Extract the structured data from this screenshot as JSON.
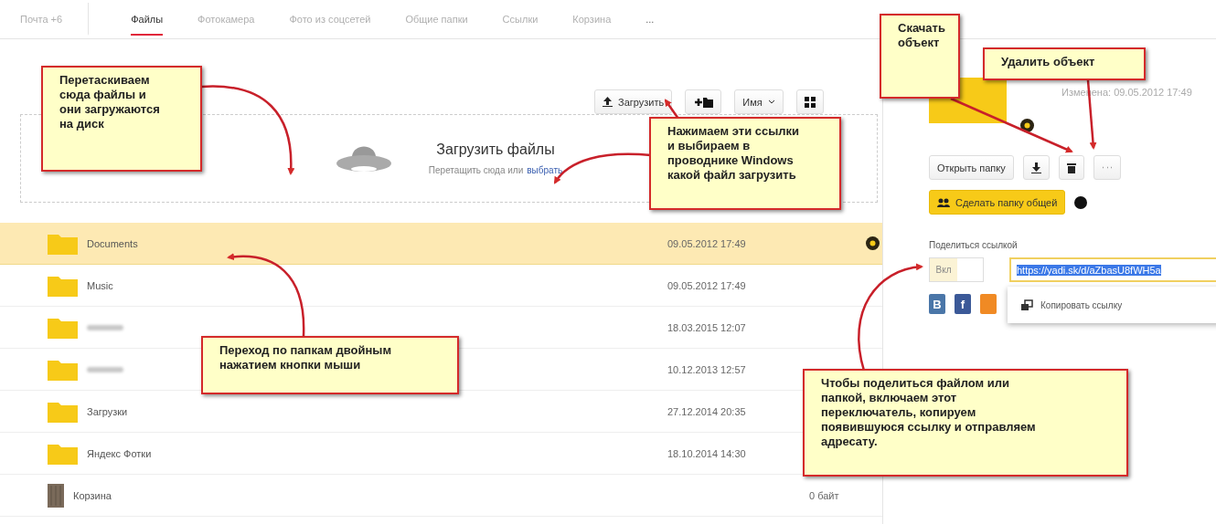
{
  "tabs": [
    {
      "label": "Почта +6",
      "selected": false
    },
    {
      "label": "Файлы",
      "selected": true
    },
    {
      "label": "Фотокамера",
      "selected": false
    },
    {
      "label": "Фото из соцсетей",
      "selected": false
    },
    {
      "label": "Общие папки",
      "selected": false
    },
    {
      "label": "Ссылки",
      "selected": false
    },
    {
      "label": "Корзина",
      "selected": false
    }
  ],
  "more_tabs": "...",
  "toolbar": {
    "upload_button": "Загрузить",
    "sort_button": "Имя"
  },
  "upload_zone": {
    "title": "Загрузить файлы",
    "hint": "Перетащить сюда или",
    "link": "выбрать"
  },
  "files": [
    {
      "kind": "folder",
      "name": "Documents",
      "date": "09.05.2012 17:49",
      "selected": true,
      "shared": true
    },
    {
      "kind": "folder",
      "name": "Music",
      "date": "09.05.2012 17:49",
      "selected": false,
      "shared": false
    },
    {
      "kind": "folder",
      "name_hidden": true,
      "date": "18.03.2015 12:07",
      "selected": false,
      "shared": false
    },
    {
      "kind": "folder",
      "name_hidden": true,
      "date": "10.12.2013 12:57",
      "selected": false,
      "shared": false
    },
    {
      "kind": "folder",
      "name": "Загрузки",
      "date": "27.12.2014 20:35",
      "selected": false,
      "shared": false
    },
    {
      "kind": "folder",
      "name": "Яндекс Фотки",
      "date": "18.10.2014 14:30",
      "selected": false,
      "shared": false
    },
    {
      "kind": "trash",
      "name": "Корзина",
      "size": "0 байт",
      "selected": false,
      "shared": false
    }
  ],
  "details": {
    "modified": "Изменена: 09.05.2012 17:49",
    "open_button": "Открыть папку",
    "share_folder_button": "Сделать папку общей",
    "share_link_label": "Поделиться ссылкой",
    "toggle_label": "Вкл",
    "link": "https://yadi.sk/d/aZbasU8fWH5a",
    "copy_link": "Копировать ссылку",
    "social": [
      {
        "label": "В",
        "color": "#4a76a8"
      },
      {
        "label": "f",
        "color": "#3b5998"
      },
      {
        "color": "#f08a24"
      }
    ]
  },
  "callouts": [
    {
      "text": "Перетаскиваем\nсюда файлы и\nони загружаются\nна диск"
    },
    {
      "text": "Нажимаем эти ссылки\nи выбираем в\nпроводнике Windows\nкакой файл загрузить"
    },
    {
      "text": "Скачать\nобъект"
    },
    {
      "text": "Удалить объект"
    },
    {
      "text": "Переход по папкам двойным\nнажатием кнопки мыши"
    },
    {
      "text": "Чтобы поделиться файлом или\nпапкой, включаем этот\nпереключатель, копируем\nпоявившуюся ссылку и отправляем\nадресату."
    }
  ]
}
